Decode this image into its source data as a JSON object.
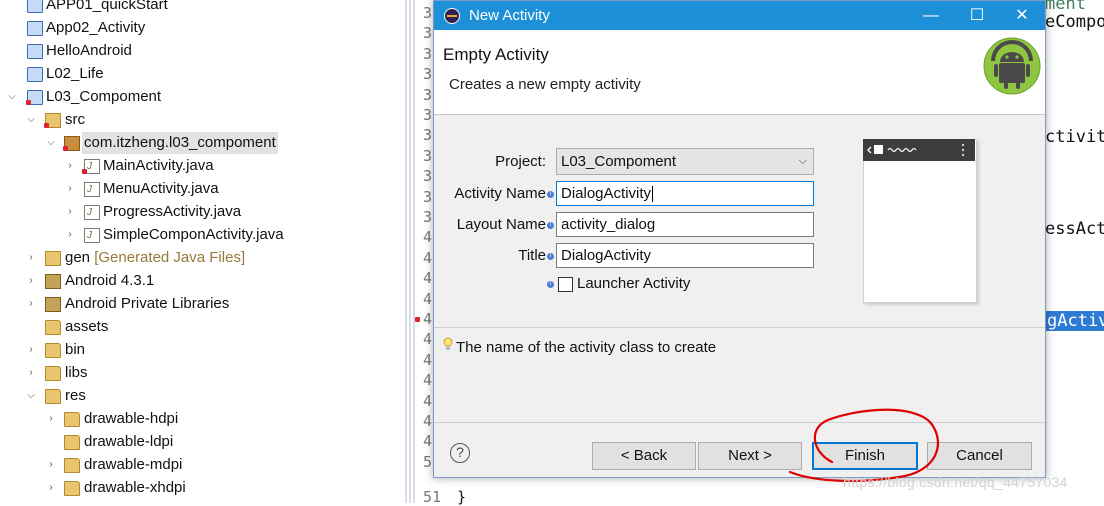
{
  "explorer": {
    "items": [
      {
        "label": "APP01_quickStart",
        "icon": "project-folder-icon"
      },
      {
        "label": "App02_Activity",
        "icon": "project-folder-icon"
      },
      {
        "label": "HelloAndroid",
        "icon": "project-folder-icon"
      },
      {
        "label": "L02_Life",
        "icon": "project-folder-icon"
      },
      {
        "label": "L03_Compoment",
        "icon": "android-project-icon",
        "expanded": true
      },
      {
        "label": "src",
        "icon": "source-folder-icon",
        "expanded": true
      },
      {
        "label": "com.itzheng.l03_compoment",
        "icon": "package-icon",
        "expanded": true,
        "selected": true
      },
      {
        "label": "MainActivity.java",
        "icon": "java-file-icon"
      },
      {
        "label": "MenuActivity.java",
        "icon": "java-file-icon"
      },
      {
        "label": "ProgressActivity.java",
        "icon": "java-file-icon"
      },
      {
        "label": "SimpleComponActivity.java",
        "icon": "java-file-icon"
      },
      {
        "label": "gen",
        "decoration": "[Generated Java Files]",
        "icon": "gen-folder-icon"
      },
      {
        "label": "Android 4.3.1",
        "icon": "library-icon"
      },
      {
        "label": "Android Private Libraries",
        "icon": "library-icon"
      },
      {
        "label": "assets",
        "icon": "folder-icon"
      },
      {
        "label": "bin",
        "icon": "folder-icon"
      },
      {
        "label": "libs",
        "icon": "folder-icon"
      },
      {
        "label": "res",
        "icon": "folder-icon",
        "expanded": true
      },
      {
        "label": "drawable-hdpi",
        "icon": "folder-icon"
      },
      {
        "label": "drawable-ldpi",
        "icon": "folder-icon"
      },
      {
        "label": "drawable-mdpi",
        "icon": "folder-icon"
      },
      {
        "label": "drawable-xhdpi",
        "icon": "folder-icon"
      }
    ]
  },
  "editor": {
    "code_fragments": [
      "ment",
      "eCompo",
      "ctivit",
      "essAct",
      "gActiv"
    ],
    "line_digits": [
      "3",
      "3",
      "3",
      "3",
      "3",
      "3",
      "3",
      "3",
      "3",
      "3",
      "3",
      "4",
      "4",
      "4",
      "4",
      "4",
      "4",
      "4",
      "4",
      "4",
      "4",
      "4",
      "5"
    ],
    "last_line_number": "51",
    "last_line_code": "}"
  },
  "dialog": {
    "title": "New Activity",
    "heading": "Empty Activity",
    "subheading": "Creates a new empty activity",
    "fields": {
      "project_label": "Project:",
      "project_value": "L03_Compoment",
      "activity_name_label": "Activity Name",
      "activity_name_value": "DialogActivity",
      "layout_name_label": "Layout Name",
      "layout_name_value": "activity_dialog",
      "title_label": "Title",
      "title_value": "DialogActivity",
      "launcher_label": "Launcher Activity"
    },
    "hint": "The name of the activity class to create",
    "buttons": {
      "back": "< Back",
      "next": "Next >",
      "finish": "Finish",
      "cancel": "Cancel"
    },
    "help_glyph": "?"
  },
  "window_controls": {
    "minimize": "—",
    "maximize": "☐",
    "close": "✕"
  },
  "watermark": "https://blog.csdn.net/qq_44757034",
  "colors": {
    "titlebar": "#1e90d8",
    "annotation": "#e00000",
    "selection_highlight": "#fff0a0"
  }
}
